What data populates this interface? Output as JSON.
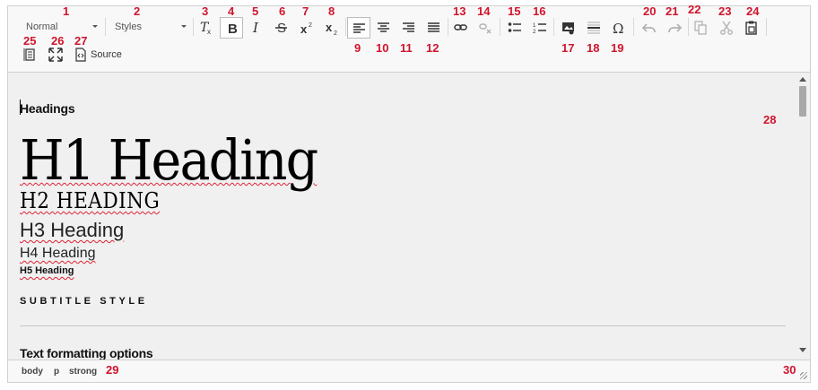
{
  "toolbar": {
    "format_combo": "Normal",
    "styles_combo": "Styles",
    "source_label": "Source",
    "markers": [
      "1",
      "2",
      "3",
      "4",
      "5",
      "6",
      "7",
      "8",
      "9",
      "10",
      "11",
      "12",
      "13",
      "14",
      "15",
      "16",
      "17",
      "18",
      "19",
      "20",
      "21",
      "22",
      "23",
      "24",
      "25",
      "26",
      "27"
    ]
  },
  "content": {
    "headings_label": "Headings",
    "h1": "H1 Heading",
    "h2": "H2 HEADING",
    "h3": "H3 Heading",
    "h4": "H4 Heading",
    "h5": "H5 Heading",
    "subtitle": "SUBTITLE STYLE",
    "text_formatting": "Text formatting options",
    "marker_28": "28"
  },
  "status": {
    "path": [
      "body",
      "p",
      "strong"
    ],
    "marker_29": "29",
    "marker_30": "30"
  },
  "colors": {
    "marker": "#d0142c",
    "toolbar_bg": "#f8f8f8",
    "content_bg": "#f0f0f0",
    "border": "#d1d1d1"
  }
}
